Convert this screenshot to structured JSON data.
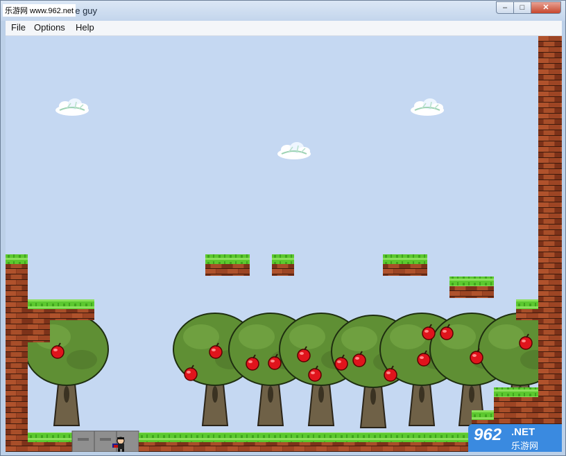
{
  "window": {
    "title": "he guy",
    "watermark_top": "乐游网 www.962.net",
    "buttons": {
      "min": "–",
      "max": "□",
      "close": "✕"
    }
  },
  "menu": {
    "items": [
      "File",
      "Options",
      "Help"
    ]
  },
  "watermark_bottom": {
    "num": "962",
    "net": ".NET",
    "cn": "乐游网"
  },
  "colors": {
    "sky": "#c5d8f2",
    "grass": "#5cc82f",
    "brick": "#8f3c1f",
    "apple": "#e0141c",
    "foliage": "#5f8f34",
    "trunk": "#6f6147",
    "ground": "#8f8f8f"
  },
  "icons": [
    "app-icon",
    "cloud-icon",
    "apple-icon",
    "player-sprite"
  ]
}
